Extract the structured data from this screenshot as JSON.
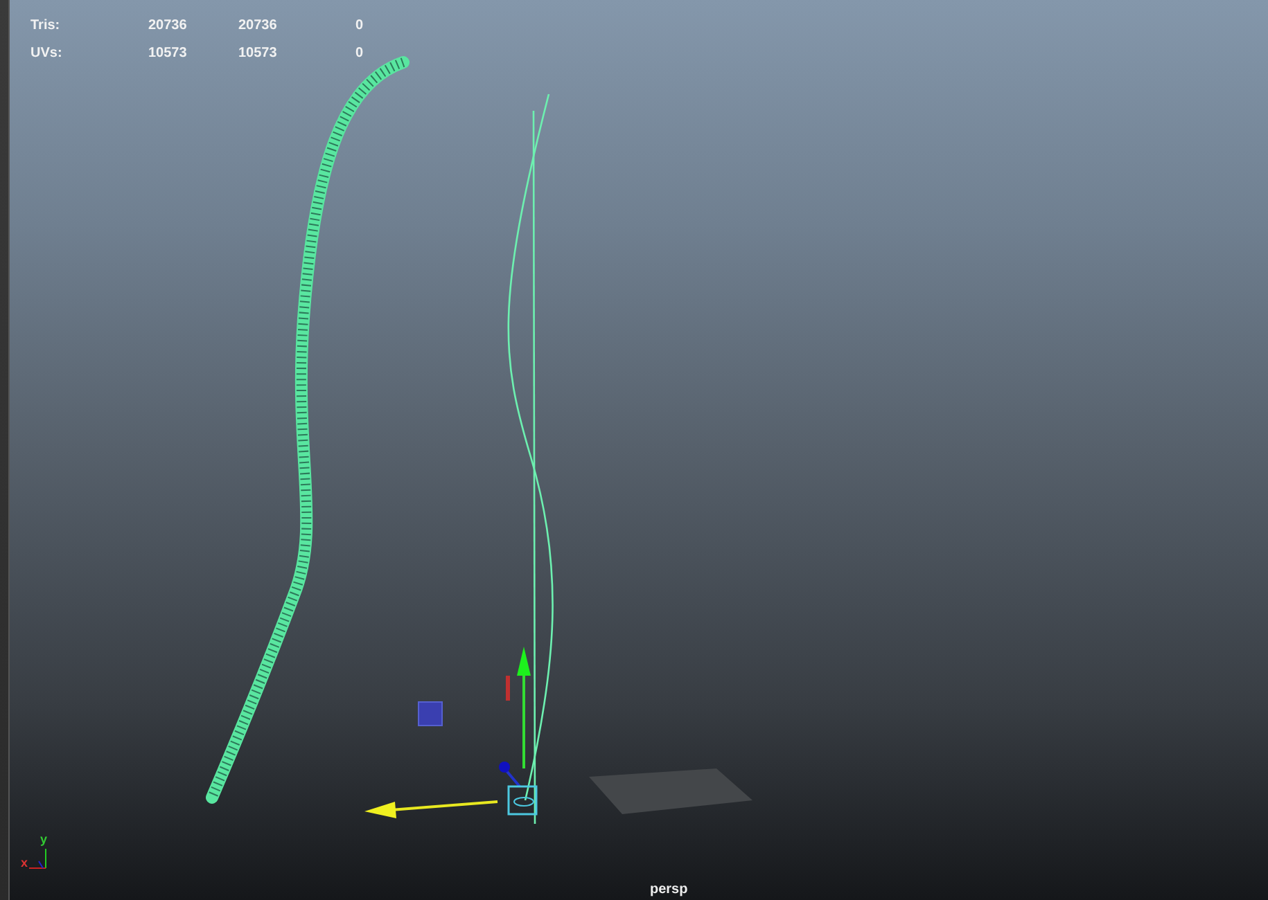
{
  "hud": {
    "rows": [
      {
        "label": "Tris:",
        "values": [
          "20736",
          "20736",
          "0"
        ]
      },
      {
        "label": "UVs:",
        "values": [
          "10573",
          "10573",
          "0"
        ]
      }
    ]
  },
  "axis_indicator": {
    "x_label": "x",
    "y_label": "y"
  },
  "camera_label": "persp"
}
